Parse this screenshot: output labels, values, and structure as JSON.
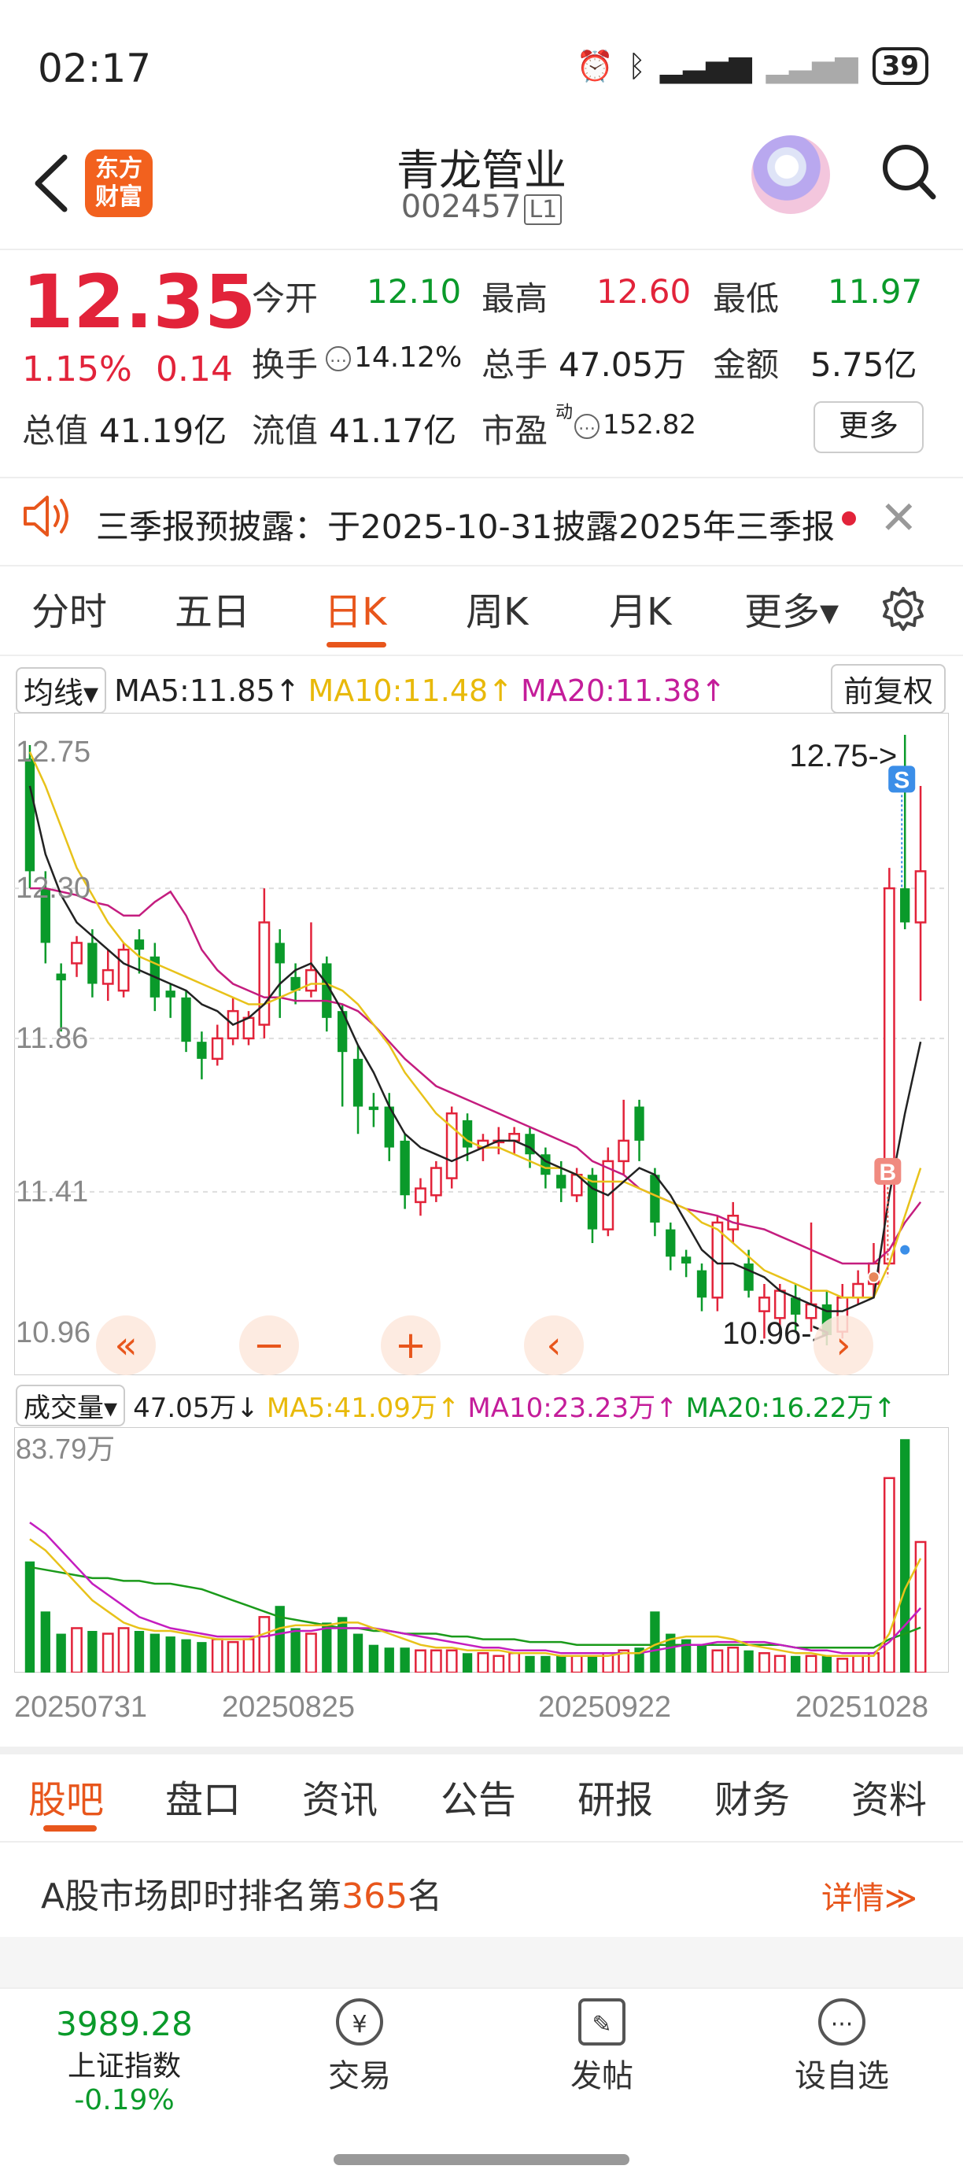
{
  "status": {
    "time": "02:17",
    "battery": "39"
  },
  "header": {
    "name": "青龙管业",
    "code": "002457",
    "level": "L1",
    "logo_line1": "东方",
    "logo_line2": "财富"
  },
  "quote": {
    "price": "12.35",
    "pct": "1.15%",
    "chg": "0.14",
    "open_label": "今开",
    "open": "12.10",
    "high_label": "最高",
    "high": "12.60",
    "low_label": "最低",
    "low": "11.97",
    "turnover_label": "换手",
    "turnover": "14.12%",
    "volume_label": "总手",
    "volume": "47.05万",
    "amount_label": "金额",
    "amount": "5.75亿",
    "mcap_label": "总值",
    "mcap": "41.19亿",
    "float_label": "流值",
    "float": "41.17亿",
    "pe_label": "市盈",
    "pe_sup": "动",
    "pe": "152.82",
    "more": "更多"
  },
  "notice": {
    "text": "三季报预披露：于2025-10-31披露2025年三季报"
  },
  "tabs": [
    "分时",
    "五日",
    "日K",
    "周K",
    "月K",
    "更多▾"
  ],
  "active_tab": "日K",
  "ma": {
    "selector": "均线▾",
    "ma5": "MA5:11.85↑",
    "ma10": "MA10:11.48↑",
    "ma20": "MA20:11.38↑",
    "adj": "前复权",
    "ma5_color": "#222222",
    "ma10_color": "#e8c21a",
    "ma20_color": "#c41d7f"
  },
  "vol_indicator": {
    "selector": "成交量▾",
    "vol": "47.05万↓",
    "ma5": "MA5:41.09万↑",
    "ma10": "MA10:23.23万↑",
    "ma20": "MA20:16.22万↑"
  },
  "chart_data": {
    "type": "candlestick",
    "y_ticks": [
      "12.75",
      "12.30",
      "11.86",
      "11.41",
      "10.96"
    ],
    "ylim": [
      10.96,
      12.75
    ],
    "high_marker": "12.75->",
    "low_marker": "10.96->",
    "buy_marker": "B",
    "sell_marker": "S",
    "x_ticks": [
      "20250731",
      "20250825",
      "20250922",
      "20251028"
    ],
    "candles": [
      [
        12.68,
        12.35,
        12.72,
        12.3
      ],
      [
        12.3,
        12.14,
        12.35,
        12.08
      ],
      [
        12.05,
        12.03,
        12.08,
        11.88
      ],
      [
        12.08,
        12.14,
        12.16,
        12.04
      ],
      [
        12.14,
        12.02,
        12.18,
        11.98
      ],
      [
        12.02,
        12.06,
        12.12,
        11.97
      ],
      [
        12.0,
        12.12,
        12.14,
        11.98
      ],
      [
        12.15,
        12.12,
        12.18,
        12.05
      ],
      [
        12.1,
        11.98,
        12.14,
        11.94
      ],
      [
        12.0,
        11.98,
        12.02,
        11.92
      ],
      [
        11.98,
        11.85,
        12.0,
        11.82
      ],
      [
        11.85,
        11.8,
        11.88,
        11.74
      ],
      [
        11.8,
        11.86,
        11.9,
        11.78
      ],
      [
        11.86,
        11.94,
        11.98,
        11.84
      ],
      [
        11.86,
        11.92,
        11.94,
        11.84
      ],
      [
        11.9,
        12.2,
        12.3,
        11.86
      ],
      [
        12.14,
        12.08,
        12.18,
        11.92
      ],
      [
        12.04,
        12.0,
        12.08,
        11.96
      ],
      [
        12.0,
        12.06,
        12.2,
        11.98
      ],
      [
        12.08,
        11.92,
        12.1,
        11.88
      ],
      [
        11.94,
        11.82,
        11.96,
        11.66
      ],
      [
        11.8,
        11.66,
        11.84,
        11.58
      ],
      [
        11.66,
        11.65,
        11.7,
        11.6
      ],
      [
        11.66,
        11.54,
        11.7,
        11.5
      ],
      [
        11.56,
        11.4,
        11.58,
        11.36
      ],
      [
        11.38,
        11.42,
        11.45,
        11.34
      ],
      [
        11.4,
        11.48,
        11.5,
        11.38
      ],
      [
        11.45,
        11.64,
        11.66,
        11.42
      ],
      [
        11.62,
        11.54,
        11.64,
        11.5
      ],
      [
        11.54,
        11.56,
        11.58,
        11.5
      ],
      [
        11.56,
        11.56,
        11.6,
        11.52
      ],
      [
        11.56,
        11.58,
        11.6,
        11.52
      ],
      [
        11.58,
        11.52,
        11.6,
        11.48
      ],
      [
        11.52,
        11.46,
        11.54,
        11.42
      ],
      [
        11.46,
        11.42,
        11.5,
        11.38
      ],
      [
        11.4,
        11.46,
        11.48,
        11.38
      ],
      [
        11.46,
        11.3,
        11.48,
        11.26
      ],
      [
        11.3,
        11.5,
        11.54,
        11.28
      ],
      [
        11.5,
        11.56,
        11.68,
        11.46
      ],
      [
        11.66,
        11.56,
        11.68,
        11.5
      ],
      [
        11.46,
        11.32,
        11.48,
        11.28
      ],
      [
        11.3,
        11.22,
        11.32,
        11.18
      ],
      [
        11.22,
        11.2,
        11.24,
        11.16
      ],
      [
        11.18,
        11.1,
        11.2,
        11.06
      ],
      [
        11.1,
        11.32,
        11.34,
        11.06
      ],
      [
        11.3,
        11.34,
        11.38,
        11.26
      ],
      [
        11.2,
        11.12,
        11.24,
        11.1
      ],
      [
        11.06,
        11.1,
        11.14,
        10.98
      ],
      [
        11.04,
        11.12,
        11.14,
        11.0
      ],
      [
        11.1,
        11.05,
        11.14,
        11.0
      ],
      [
        11.04,
        11.08,
        11.32,
        11.0
      ],
      [
        11.08,
        10.99,
        11.12,
        10.96
      ],
      [
        11.0,
        11.1,
        11.14,
        10.98
      ],
      [
        11.1,
        11.14,
        11.18,
        11.08
      ],
      [
        11.14,
        11.2,
        11.26,
        11.1
      ],
      [
        11.2,
        12.3,
        12.36,
        11.2
      ],
      [
        12.3,
        12.2,
        12.75,
        12.18
      ],
      [
        12.2,
        12.35,
        12.6,
        11.97
      ]
    ],
    "ma5": [
      12.6,
      12.4,
      12.28,
      12.2,
      12.16,
      12.12,
      12.08,
      12.06,
      12.04,
      12.02,
      12.0,
      11.96,
      11.94,
      11.9,
      11.92,
      11.96,
      12.02,
      12.06,
      12.08,
      12.02,
      11.94,
      11.84,
      11.76,
      11.66,
      11.58,
      11.54,
      11.52,
      11.5,
      11.52,
      11.54,
      11.56,
      11.56,
      11.54,
      11.5,
      11.48,
      11.46,
      11.42,
      11.4,
      11.44,
      11.48,
      11.46,
      11.4,
      11.32,
      11.24,
      11.2,
      11.2,
      11.18,
      11.16,
      11.12,
      11.1,
      11.08,
      11.06,
      11.06,
      11.08,
      11.1,
      11.4,
      11.64,
      11.85
    ],
    "ma10": [
      12.7,
      12.6,
      12.48,
      12.36,
      12.28,
      12.2,
      12.14,
      12.1,
      12.08,
      12.06,
      12.04,
      12.02,
      12.0,
      11.98,
      11.96,
      11.96,
      11.98,
      12.0,
      12.02,
      12.02,
      12.0,
      11.96,
      11.9,
      11.84,
      11.76,
      11.7,
      11.64,
      11.6,
      11.56,
      11.54,
      11.54,
      11.52,
      11.5,
      11.48,
      11.48,
      11.46,
      11.44,
      11.44,
      11.44,
      11.42,
      11.4,
      11.38,
      11.36,
      11.32,
      11.3,
      11.26,
      11.22,
      11.18,
      11.16,
      11.14,
      11.12,
      11.12,
      11.1,
      11.1,
      11.1,
      11.2,
      11.34,
      11.48
    ],
    "ma20": [
      12.3,
      12.3,
      12.29,
      12.28,
      12.26,
      12.25,
      12.22,
      12.22,
      12.26,
      12.29,
      12.22,
      12.12,
      12.06,
      12.02,
      12.0,
      11.98,
      11.98,
      11.97,
      11.97,
      11.97,
      11.96,
      11.94,
      11.9,
      11.85,
      11.8,
      11.76,
      11.72,
      11.7,
      11.68,
      11.66,
      11.64,
      11.62,
      11.6,
      11.58,
      11.56,
      11.54,
      11.5,
      11.48,
      11.46,
      11.42,
      11.4,
      11.38,
      11.36,
      11.35,
      11.34,
      11.32,
      11.31,
      11.3,
      11.28,
      11.26,
      11.24,
      11.22,
      11.2,
      11.2,
      11.2,
      11.24,
      11.32,
      11.38
    ],
    "volume_ylabel": "83.79万",
    "volume_max": 83.79,
    "volumes": [
      40,
      22,
      14,
      16,
      15,
      14,
      16,
      15,
      14,
      13,
      12,
      11,
      12,
      11,
      12,
      20,
      24,
      16,
      14,
      18,
      20,
      14,
      10,
      9,
      9,
      8,
      8,
      8,
      7,
      7,
      6,
      7,
      6,
      6,
      6,
      6,
      6,
      7,
      8,
      9,
      22,
      14,
      12,
      10,
      8,
      9,
      8,
      7,
      6,
      6,
      6,
      6,
      5,
      6,
      7,
      70,
      84,
      47
    ],
    "vol_ma5": [
      48,
      44,
      38,
      32,
      26,
      22,
      18,
      16,
      15,
      15,
      14,
      13,
      12,
      12,
      12,
      14,
      16,
      17,
      17,
      17,
      18,
      18,
      16,
      14,
      12,
      10,
      9,
      9,
      8,
      8,
      8,
      7,
      7,
      7,
      6,
      6,
      6,
      6,
      7,
      7,
      10,
      12,
      13,
      13,
      13,
      12,
      10,
      9,
      8,
      7,
      7,
      6,
      6,
      6,
      6,
      14,
      30,
      41.09
    ],
    "vol_ma10": [
      54,
      50,
      44,
      38,
      32,
      28,
      24,
      20,
      18,
      16,
      15,
      14,
      13,
      13,
      13,
      13,
      14,
      15,
      15,
      16,
      16,
      16,
      16,
      15,
      14,
      13,
      12,
      11,
      10,
      9,
      9,
      8,
      8,
      8,
      7,
      7,
      7,
      7,
      7,
      7,
      8,
      9,
      10,
      10,
      11,
      11,
      11,
      11,
      10,
      9,
      8,
      8,
      7,
      7,
      7,
      11,
      17,
      23.23
    ],
    "vol_ma20": [
      38,
      37,
      36,
      35,
      34,
      34,
      33,
      33,
      32,
      32,
      31,
      30,
      28,
      26,
      24,
      22,
      20,
      19,
      18,
      17,
      16,
      16,
      15,
      15,
      14,
      14,
      14,
      13,
      13,
      12,
      12,
      12,
      11,
      11,
      11,
      10,
      10,
      10,
      10,
      10,
      10,
      10,
      10,
      10,
      10,
      10,
      10,
      10,
      10,
      9,
      9,
      9,
      9,
      9,
      9,
      12,
      14,
      16.22
    ]
  },
  "bottom_tabs": [
    "股吧",
    "盘口",
    "资讯",
    "公告",
    "研报",
    "财务",
    "资料"
  ],
  "active_bottom_tab": "股吧",
  "rank": {
    "prefix": "A股市场即时排名第",
    "num": "365",
    "suffix": "名",
    "detail": "详情≫"
  },
  "nav": {
    "index_value": "3989.28",
    "index_label": "上证指数",
    "index_change": "-0.19%",
    "trade": "交易",
    "post": "发帖",
    "watch": "设自选"
  },
  "colors": {
    "up": "#e2233a",
    "down": "#0a9a2a",
    "accent": "#e8561c"
  }
}
